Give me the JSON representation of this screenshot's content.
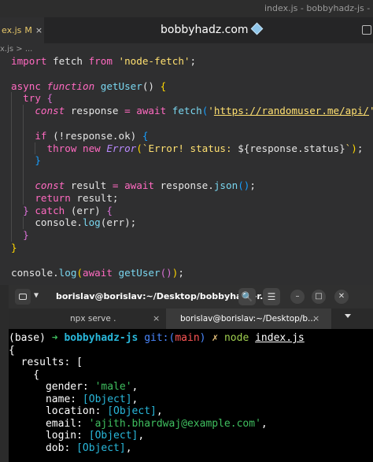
{
  "editor": {
    "window_title": "index.js - bobbyhadz-js - Visu",
    "tab": {
      "label": "ex.js",
      "modified": "M",
      "close": "×"
    },
    "brand": "bobbyhadz.com",
    "breadcrumb": "x.js > ...",
    "code": {
      "l1_import": "import",
      "l1_fetch": " fetch ",
      "l1_from": "from",
      "l1_str": " 'node-fetch'",
      "l1_semi": ";",
      "l3_async": "async ",
      "l3_function": "function ",
      "l3_name": "getUser",
      "l3_paren": "() ",
      "l3_brace": "{",
      "l4_try": "try ",
      "l4_brace": "{",
      "l5_const": "const ",
      "l5_var": "response ",
      "l5_eq": "= ",
      "l5_await": "await ",
      "l5_fetch": "fetch",
      "l5_open": "(",
      "l5_q1": "'",
      "l5_url": "https://randomuser.me/api/",
      "l5_q2": "'",
      "l5_close": ")",
      "l5_semi": ";",
      "l7_if": "if ",
      "l7_cond": "(!response.ok) ",
      "l7_brace": "{",
      "l8_throw": "throw ",
      "l8_new": "new ",
      "l8_error": "Error",
      "l8_open": "(",
      "l8_tpl1": "`Error! status: ",
      "l8_expr": "${response.status}",
      "l8_tpl2": "`",
      "l8_close": ")",
      "l8_semi": ";",
      "l9_brace": "}",
      "l11_const": "const ",
      "l11_var": "result ",
      "l11_eq": "= ",
      "l11_await": "await ",
      "l11_obj": "response.",
      "l11_json": "json",
      "l11_paren": "()",
      "l11_semi": ";",
      "l12_return": "return ",
      "l12_rest": "result;",
      "l13_brace": "} ",
      "l13_catch": "catch ",
      "l13_err": "(err) ",
      "l13_open": "{",
      "l14_obj": "console.",
      "l14_log": "log",
      "l14_args": "(err);",
      "l15_brace": "}",
      "l16_brace": "}",
      "l18_obj": "console.",
      "l18_log": "log",
      "l18_open": "(",
      "l18_await": "await ",
      "l18_fn": "getUser",
      "l18_paren": "()",
      "l18_close": ")",
      "l18_semi": ";"
    }
  },
  "terminal": {
    "title": "borislav@borislav:~/Desktop/bobbyhadz-r...",
    "tabs": [
      {
        "label": "npx serve .",
        "close": "×"
      },
      {
        "label": "borislav@borislav:~/Desktop/b...",
        "close": "×"
      }
    ],
    "search_glyph": "🔍",
    "menu_glyph": "☰",
    "minimize_glyph": "–",
    "maximize_glyph": "□",
    "close_glyph": "✕",
    "prompt": {
      "base": "(base)",
      "arrow": "➜",
      "dir": "bobbyhadz-js",
      "git": "git:(",
      "branch": "main",
      "git_close": ")",
      "dirty": "✗",
      "cmd": "node",
      "file": "index.js"
    },
    "output": {
      "o1": "{",
      "o2": "  results: [",
      "o3": "    {",
      "gender_key": "      gender: ",
      "gender_val": "'male'",
      "name_key": "      name: ",
      "name_val": "[Object]",
      "location_key": "      location: ",
      "location_val": "[Object]",
      "email_key": "      email: ",
      "email_val": "'ajith.bhardwaj@example.com'",
      "login_key": "      login: ",
      "login_val": "[Object]",
      "dob_key": "      dob: ",
      "dob_val": "[Object]",
      "comma": ","
    }
  }
}
